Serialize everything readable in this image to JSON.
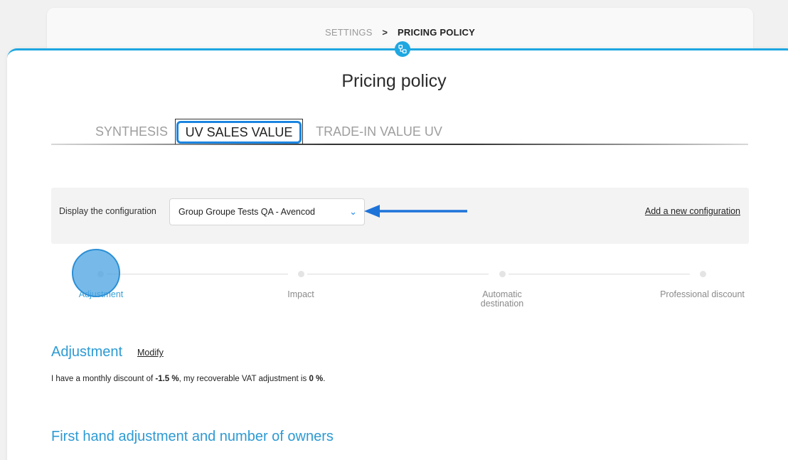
{
  "breadcrumb": {
    "previous": "SETTINGS",
    "separator": ">",
    "current": "PRICING POLICY"
  },
  "page": {
    "title": "Pricing policy"
  },
  "tabs": [
    {
      "label": "SYNTHESIS",
      "active": false
    },
    {
      "label": "UV SALES VALUE",
      "active": true
    },
    {
      "label": "TRADE-IN VALUE UV",
      "active": false
    }
  ],
  "config": {
    "label": "Display the configuration",
    "selected": "Group Groupe Tests QA - Avencod",
    "add_link": "Add a new configuration"
  },
  "steps": [
    {
      "label": "Adjustment",
      "active": true
    },
    {
      "label": "Impact",
      "active": false
    },
    {
      "label": "Automatic destination",
      "line1": "Automatic",
      "line2": "destination",
      "active": false
    },
    {
      "label": "Professional discount",
      "active": false
    }
  ],
  "adjustment": {
    "title": "Adjustment",
    "modify_label": "Modify",
    "desc_prefix": "I have a monthly discount of ",
    "discount_value": "-1.5 %",
    "desc_middle": ", my recoverable VAT adjustment is ",
    "vat_value": "0 %",
    "desc_suffix": "."
  },
  "next_section": {
    "title": "First hand adjustment and number of owners"
  },
  "colors": {
    "accent": "#1ea7e1",
    "highlight": "#1b85e0",
    "section_title": "#2d9ad3"
  },
  "icons": {
    "header": "pricing-policy-icon",
    "dropdown": "chevron-down-icon",
    "annotation": "arrow-left-icon"
  }
}
